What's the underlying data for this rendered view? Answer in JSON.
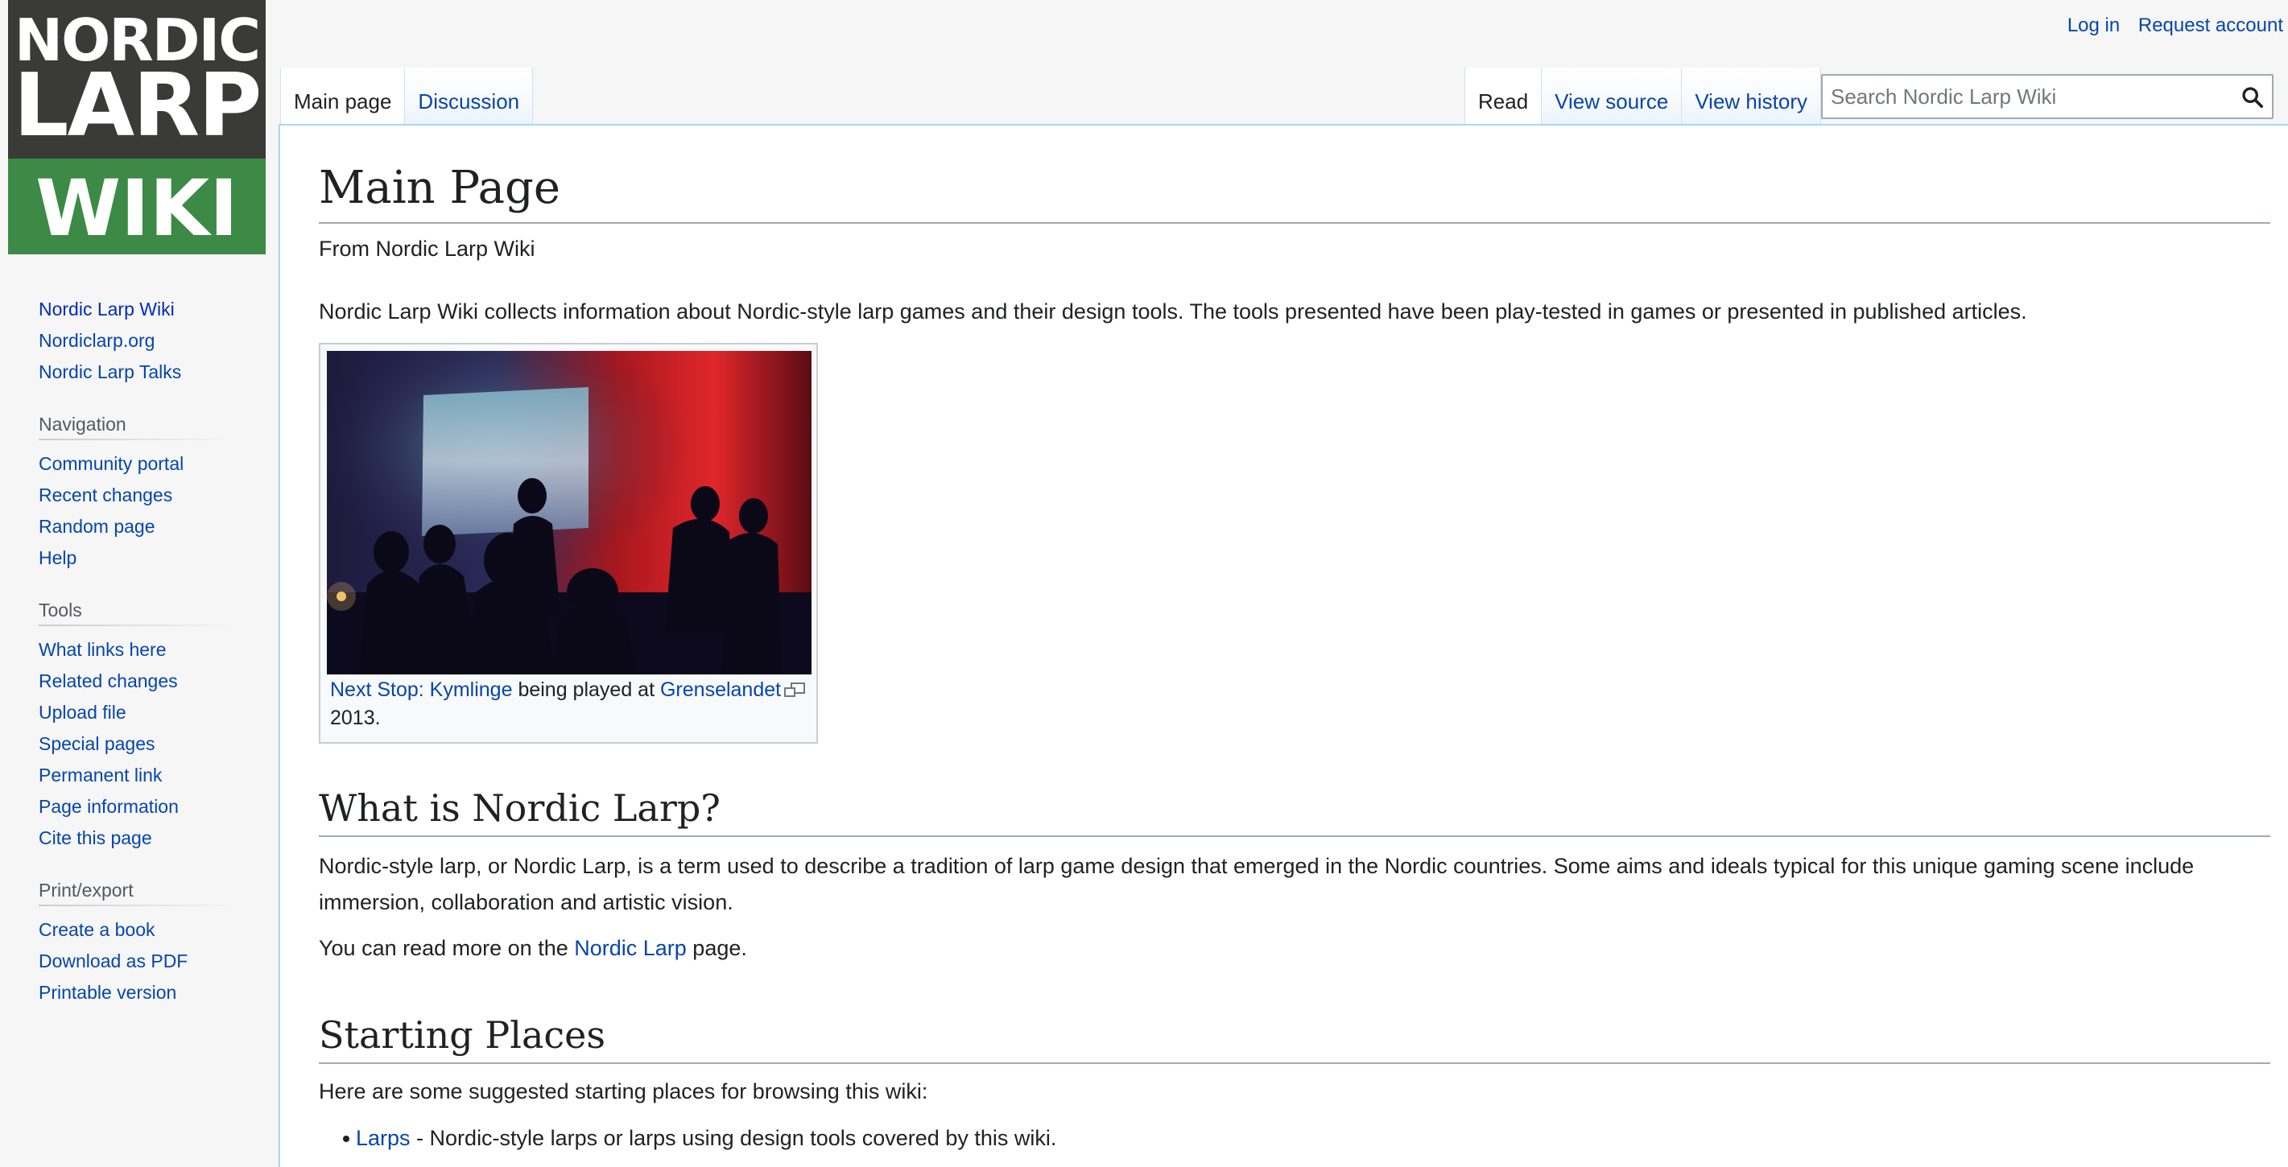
{
  "logo": {
    "line1": "NORDIC",
    "line2": "LARP",
    "line3": "WIKI"
  },
  "personal": {
    "login": "Log in",
    "request": "Request account"
  },
  "tabs_left": [
    {
      "label": "Main page",
      "selected": true
    },
    {
      "label": "Discussion",
      "selected": false
    }
  ],
  "tabs_right": [
    {
      "label": "Read",
      "selected": true
    },
    {
      "label": "View source",
      "selected": false
    },
    {
      "label": "View history",
      "selected": false
    }
  ],
  "search": {
    "placeholder": "Search Nordic Larp Wiki",
    "icon": "search-icon"
  },
  "sidebar": {
    "top_links": [
      "Nordic Larp Wiki",
      "Nordiclarp.org",
      "Nordic Larp Talks"
    ],
    "navigation": {
      "heading": "Navigation",
      "items": [
        "Community portal",
        "Recent changes",
        "Random page",
        "Help"
      ]
    },
    "tools": {
      "heading": "Tools",
      "items": [
        "What links here",
        "Related changes",
        "Upload file",
        "Special pages",
        "Permanent link",
        "Page information",
        "Cite this page"
      ]
    },
    "print": {
      "heading": "Print/export",
      "items": [
        "Create a book",
        "Download as PDF",
        "Printable version"
      ]
    }
  },
  "article": {
    "title": "Main Page",
    "tagline": "From Nordic Larp Wiki",
    "intro": "Nordic Larp Wiki collects information about Nordic-style larp games and their design tools. The tools presented have been play-tested in games or presented in published articles.",
    "thumb": {
      "caption_link1": "Next Stop: Kymlinge",
      "caption_mid": " being played at ",
      "caption_link2": "Grenselandet",
      "caption_end": "2013."
    },
    "what_heading": "What is Nordic Larp?",
    "what_text": "Nordic-style larp, or Nordic Larp, is a term used to describe a tradition of larp game design that emerged in the Nordic countries. Some aims and ideals typical for this unique gaming scene include immersion, collaboration and artistic vision.",
    "more_prefix": "You can read more on the ",
    "more_link": "Nordic Larp",
    "more_suffix": " page.",
    "start_heading": "Starting Places",
    "start_text": "Here are some suggested starting places for browsing this wiki:",
    "start_items": [
      {
        "link": "Larps",
        "text": " - Nordic-style larps or larps using design tools covered by this wiki."
      }
    ]
  },
  "colors": {
    "link": "#0645ad",
    "logo_dark": "#3a3a38",
    "logo_green": "#3c8a45",
    "tab_border": "#a7d7f9"
  }
}
